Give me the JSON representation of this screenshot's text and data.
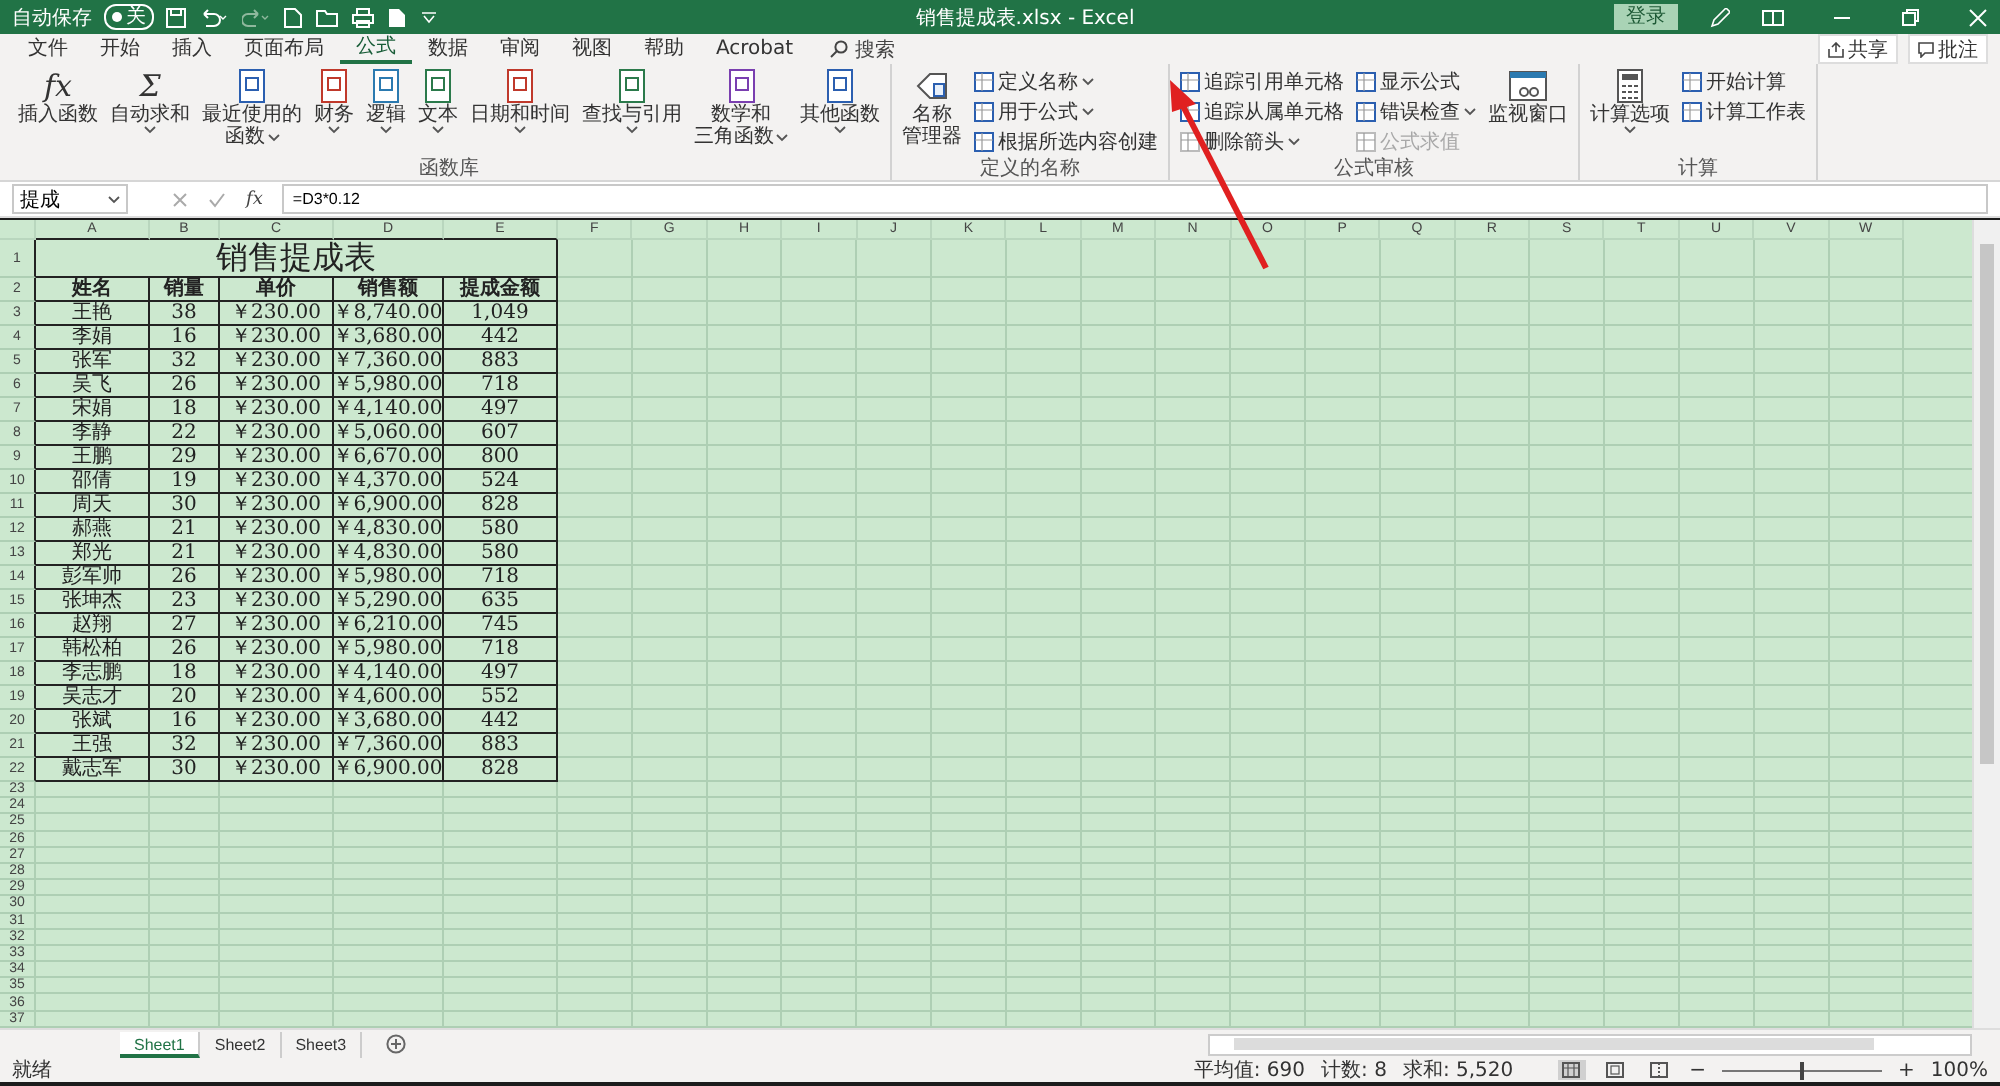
{
  "title_bar": {
    "autosave_label": "自动保存",
    "autosave_on": false,
    "autosave_state": "关",
    "file_title": "销售提成表.xlsx - Excel",
    "sign_in": "登录"
  },
  "ribbon_tabs": [
    {
      "label": "文件",
      "selected": false
    },
    {
      "label": "开始",
      "selected": false
    },
    {
      "label": "插入",
      "selected": false
    },
    {
      "label": "页面布局",
      "selected": false
    },
    {
      "label": "公式",
      "selected": true
    },
    {
      "label": "数据",
      "selected": false
    },
    {
      "label": "审阅",
      "selected": false
    },
    {
      "label": "视图",
      "selected": false
    },
    {
      "label": "帮助",
      "selected": false
    },
    {
      "label": "Acrobat",
      "selected": false
    }
  ],
  "search": {
    "placeholder": "搜索"
  },
  "share": "共享",
  "comments": "批注",
  "ribbon_groups": [
    {
      "label": "函数库",
      "items": [
        {
          "kind": "large",
          "glyph": "fx",
          "lines": [
            "插入函数"
          ],
          "dropdown": false
        },
        {
          "kind": "large",
          "glyph": "Σ",
          "lines": [
            "自动求和"
          ],
          "dropdown": true
        },
        {
          "kind": "large",
          "lines": [
            "最近使用的",
            "函数"
          ],
          "dropdown": true
        },
        {
          "kind": "large",
          "lines": [
            "财务"
          ],
          "dropdown": true
        },
        {
          "kind": "large",
          "lines": [
            "逻辑"
          ],
          "dropdown": true
        },
        {
          "kind": "large",
          "lines": [
            "文本"
          ],
          "dropdown": true
        },
        {
          "kind": "large",
          "lines": [
            "日期和时间"
          ],
          "dropdown": true
        },
        {
          "kind": "large",
          "lines": [
            "查找与引用"
          ],
          "dropdown": true
        },
        {
          "kind": "large",
          "lines": [
            "数学和",
            "三角函数"
          ],
          "dropdown": true
        },
        {
          "kind": "large",
          "lines": [
            "其他函数"
          ],
          "dropdown": true
        }
      ]
    },
    {
      "label": "定义的名称",
      "items": [
        {
          "kind": "large",
          "lines": [
            "名称",
            "管理器"
          ],
          "dropdown": false
        },
        {
          "kind": "stack",
          "entries": [
            {
              "label": "定义名称",
              "dropdown": true,
              "disabled": false
            },
            {
              "label": "用于公式",
              "dropdown": true,
              "disabled": false
            },
            {
              "label": "根据所选内容创建",
              "dropdown": false,
              "disabled": false
            }
          ]
        }
      ]
    },
    {
      "label": "公式审核",
      "items": [
        {
          "kind": "stack",
          "entries": [
            {
              "label": "追踪引用单元格",
              "dropdown": false,
              "disabled": false
            },
            {
              "label": "追踪从属单元格",
              "dropdown": false,
              "disabled": false
            },
            {
              "label": "删除箭头",
              "dropdown": true,
              "disabled": false
            }
          ]
        },
        {
          "kind": "stack",
          "entries": [
            {
              "label": "显示公式",
              "dropdown": false,
              "disabled": false
            },
            {
              "label": "错误检查",
              "dropdown": true,
              "disabled": false
            },
            {
              "label": "公式求值",
              "dropdown": false,
              "disabled": true
            }
          ]
        },
        {
          "kind": "large",
          "lines": [
            "监视窗口"
          ],
          "dropdown": false
        }
      ]
    },
    {
      "label": "计算",
      "items": [
        {
          "kind": "large",
          "lines": [
            "计算选项"
          ],
          "dropdown": true
        },
        {
          "kind": "stack",
          "entries": [
            {
              "label": "开始计算",
              "dropdown": false,
              "disabled": false
            },
            {
              "label": "计算工作表",
              "dropdown": false,
              "disabled": false
            }
          ]
        }
      ]
    }
  ],
  "formula_bar": {
    "name_box": "提成",
    "fx": "fx",
    "formula": "=D3*0.12"
  },
  "sheet": {
    "columns": [
      "A",
      "B",
      "C",
      "D",
      "E",
      "F",
      "G",
      "H",
      "I",
      "J",
      "K",
      "L",
      "M",
      "N",
      "O",
      "P",
      "Q",
      "R",
      "S",
      "T",
      "U",
      "V",
      "W"
    ],
    "row_labels": [
      "1",
      "2",
      "3",
      "4",
      "5",
      "6",
      "7",
      "8",
      "9",
      "10",
      "11",
      "12",
      "13",
      "14",
      "15",
      "16",
      "17",
      "18",
      "19",
      "20",
      "21",
      "22",
      "23",
      "24",
      "25",
      "26",
      "27",
      "28",
      "29",
      "30",
      "31",
      "32",
      "33",
      "34",
      "35",
      "36",
      "37"
    ],
    "title": "销售提成表",
    "headers": [
      "姓名",
      "销量",
      "单价",
      "销售额",
      "提成金额"
    ],
    "rows": [
      [
        "王艳",
        "38",
        "￥230.00",
        "￥8,740.00",
        "1,049"
      ],
      [
        "李娟",
        "16",
        "￥230.00",
        "￥3,680.00",
        "442"
      ],
      [
        "张军",
        "32",
        "￥230.00",
        "￥7,360.00",
        "883"
      ],
      [
        "吴飞",
        "26",
        "￥230.00",
        "￥5,980.00",
        "718"
      ],
      [
        "宋娟",
        "18",
        "￥230.00",
        "￥4,140.00",
        "497"
      ],
      [
        "李静",
        "22",
        "￥230.00",
        "￥5,060.00",
        "607"
      ],
      [
        "王鹏",
        "29",
        "￥230.00",
        "￥6,670.00",
        "800"
      ],
      [
        "邵倩",
        "19",
        "￥230.00",
        "￥4,370.00",
        "524"
      ],
      [
        "周天",
        "30",
        "￥230.00",
        "￥6,900.00",
        "828"
      ],
      [
        "郝燕",
        "21",
        "￥230.00",
        "￥4,830.00",
        "580"
      ],
      [
        "郑光",
        "21",
        "￥230.00",
        "￥4,830.00",
        "580"
      ],
      [
        "彭军帅",
        "26",
        "￥230.00",
        "￥5,980.00",
        "718"
      ],
      [
        "张坤杰",
        "23",
        "￥230.00",
        "￥5,290.00",
        "635"
      ],
      [
        "赵翔",
        "27",
        "￥230.00",
        "￥6,210.00",
        "745"
      ],
      [
        "韩松柏",
        "26",
        "￥230.00",
        "￥5,980.00",
        "718"
      ],
      [
        "李志鹏",
        "18",
        "￥230.00",
        "￥4,140.00",
        "497"
      ],
      [
        "吴志才",
        "20",
        "￥230.00",
        "￥4,600.00",
        "552"
      ],
      [
        "张斌",
        "16",
        "￥230.00",
        "￥3,680.00",
        "442"
      ],
      [
        "王强",
        "32",
        "￥230.00",
        "￥7,360.00",
        "883"
      ],
      [
        "戴志军",
        "30",
        "￥230.00",
        "￥6,900.00",
        "828"
      ]
    ]
  },
  "sheet_tabs": [
    {
      "label": "Sheet1",
      "selected": true
    },
    {
      "label": "Sheet2",
      "selected": false
    },
    {
      "label": "Sheet3",
      "selected": false
    }
  ],
  "status_bar": {
    "mode": "就绪",
    "average": "平均值: 690",
    "count": "计数: 8",
    "sum": "求和: 5,520",
    "views": [
      {
        "selected": true
      },
      {
        "selected": false
      },
      {
        "selected": false
      }
    ],
    "zoom_out": "−",
    "zoom": {
      "level": 0.5
    },
    "zoom_in": "+",
    "zoom_label": "100%"
  }
}
